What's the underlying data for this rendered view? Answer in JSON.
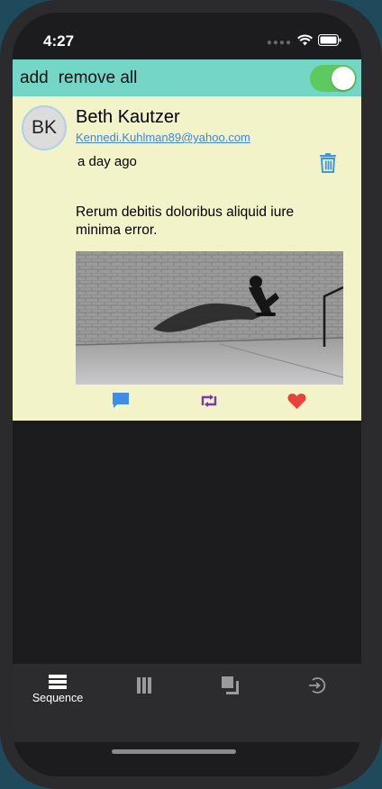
{
  "status_bar": {
    "time": "4:27"
  },
  "toolbar": {
    "add_label": "add",
    "remove_all_label": "remove all",
    "toggle_on": true
  },
  "post": {
    "avatar_initials": "BK",
    "author_name": "Beth Kautzer",
    "author_email": "Kennedi.Kuhlman89@yahoo.com",
    "time_ago": "a day ago",
    "body": "Rerum debitis doloribus aliquid iure minima error.",
    "image_alt": "Person on a skateboard casting a long shadow on brick pavement"
  },
  "tabs": [
    {
      "label": "Sequence",
      "icon": "list-icon",
      "selected": true
    },
    {
      "label": "",
      "icon": "columns-icon",
      "selected": false
    },
    {
      "label": "",
      "icon": "layers-icon",
      "selected": false
    },
    {
      "label": "",
      "icon": "login-icon",
      "selected": false
    }
  ],
  "colors": {
    "toolbar_bg": "#73d6c6",
    "card_bg": "#f2f3c8",
    "toggle_on": "#5ec95e",
    "link_blue": "#3e86d6",
    "comment_icon": "#3d8ee8",
    "retweet_icon": "#7a3aa8",
    "heart_icon": "#e8433a"
  }
}
